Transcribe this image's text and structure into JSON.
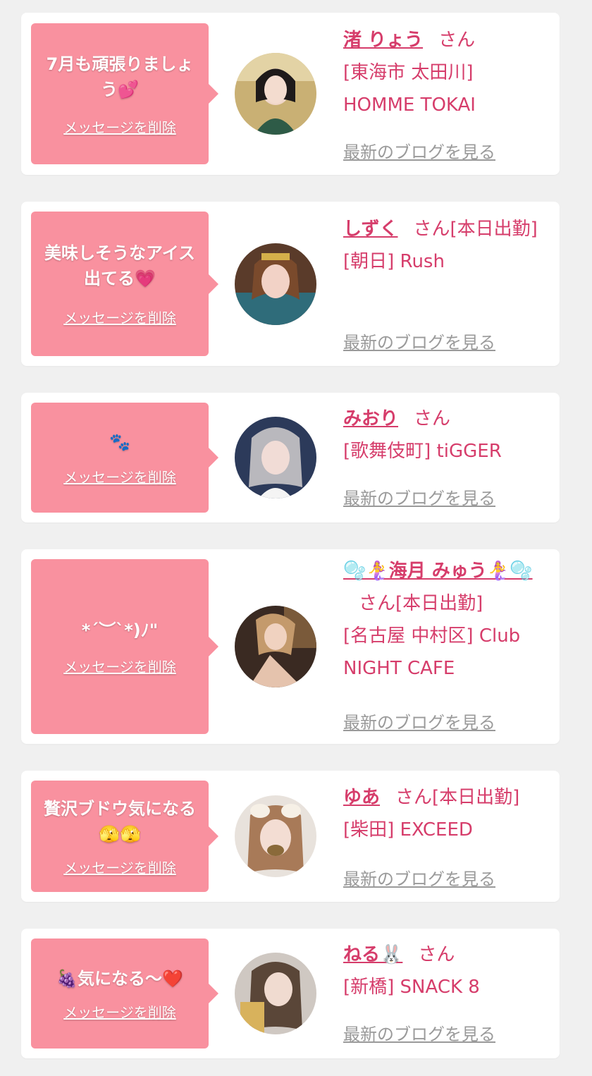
{
  "delete_label": "メッセージを削除",
  "blog_label": "最新のブログを見る",
  "honorific": "さん",
  "colors": {
    "page_bg": "#f0f0f0",
    "card_bg": "#ffffff",
    "bubble_bg": "#f9919f",
    "accent_text": "#d63d6b",
    "link_gray": "#9a9a9a"
  },
  "entries": [
    {
      "message": "7月も頑張りましょう💕",
      "name": "渚 りょう",
      "status": "",
      "shop": "[東海市 太田川] HOMME TOKAI"
    },
    {
      "message": "美味しそうなアイス出てる💗",
      "name": "しずく",
      "status": "[本日出勤]",
      "shop": "[朝日] Rush"
    },
    {
      "message": "🐾",
      "name": "みおり",
      "status": "",
      "shop": "[歌舞伎町] tiGGER"
    },
    {
      "message": "*´︶`*)ﾉ\"",
      "name": "🫧🧜‍♀️海月 みゅう🧜‍♀️🫧",
      "status": "[本日出勤]",
      "shop": "[名古屋 中村区] Club NIGHT CAFE"
    },
    {
      "message": "贅沢ブドウ気になる🫣🫣",
      "name": "ゆあ",
      "status": "[本日出勤]",
      "shop": "[柴田] EXCEED"
    },
    {
      "message": "🍇気になる〜❤️",
      "name": "ねる🐰",
      "status": "",
      "shop": "[新橋] SNACK 8"
    }
  ]
}
